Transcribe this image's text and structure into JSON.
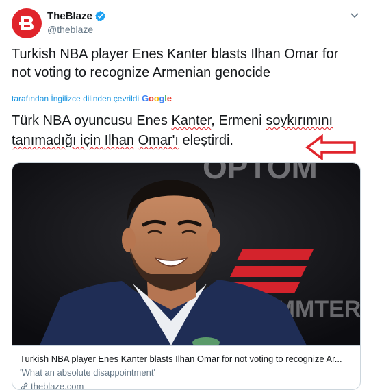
{
  "account": {
    "display_name": "TheBlaze",
    "handle": "@theblaze",
    "verified": true,
    "avatar_icon": "theblaze-logo-icon",
    "brand_color": "#e0242b"
  },
  "tweet": {
    "text": "Turkish NBA player Enes Kanter blasts Ilhan Omar for not voting to recognize Armenian genocide"
  },
  "translation": {
    "label": "tarafından İngilizce dilinden çevrildi",
    "provider": "Google",
    "line1_a": "Türk NBA oyuncusu Enes ",
    "line1_b": "Kanter",
    "line1_c": ", Ermeni ",
    "line1_d": "soykırımını",
    "line2_a": "tanımadığı için ",
    "line2_b": "Ilhan",
    "line2_c": " ",
    "line2_d": "Omar'ı",
    "line2_e": " eleştirdi."
  },
  "card": {
    "title": "Turkish NBA player Enes Kanter blasts Ilhan Omar for not voting to recognize Ar...",
    "description": "'What an absolute disappointment'",
    "domain": "theblaze.com",
    "image_icon": "smiling-man-photo",
    "bg_text_top": "OPTOM",
    "bg_text_mid": "EMMTER"
  },
  "colors": {
    "link": "#1b95e0",
    "secondary": "#657786",
    "arrow": "#e0242b"
  }
}
